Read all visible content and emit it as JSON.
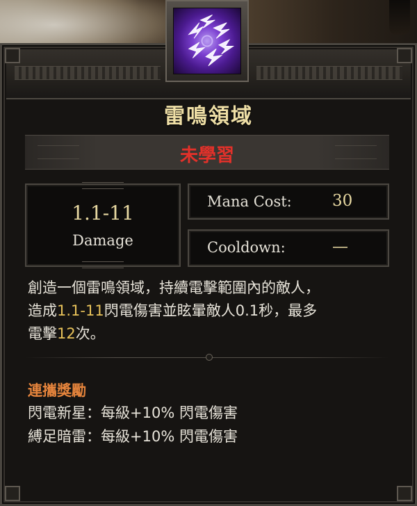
{
  "skill": {
    "icon": "lightning-field-icon",
    "name": "雷鳴領域",
    "status": "未學習"
  },
  "stats": {
    "damage_value": "1.1-11",
    "damage_label": "Damage",
    "mana_label": "Mana Cost:",
    "mana_value": "30",
    "cooldown_label": "Cooldown:",
    "cooldown_value": "—"
  },
  "description": {
    "line1": "創造一個雷鳴領域，持續電擊範圍內的敵人，",
    "line2_pre": "造成",
    "line2_hl": "1.1-11",
    "line2_post": "閃電傷害並眩暈敵人0.1秒，最多",
    "line3_pre": "電擊",
    "line3_hl": "12",
    "line3_post": "次。"
  },
  "synergy": {
    "title": "連攜獎勵",
    "lines": [
      "閃電新星：每級+10% 閃電傷害",
      "縛足暗雷：每級+10% 閃電傷害"
    ]
  },
  "colors": {
    "title": "#efdfa6",
    "status": "#e2312a",
    "highlight": "#e8c25a",
    "synergy_title": "#e5843c"
  }
}
